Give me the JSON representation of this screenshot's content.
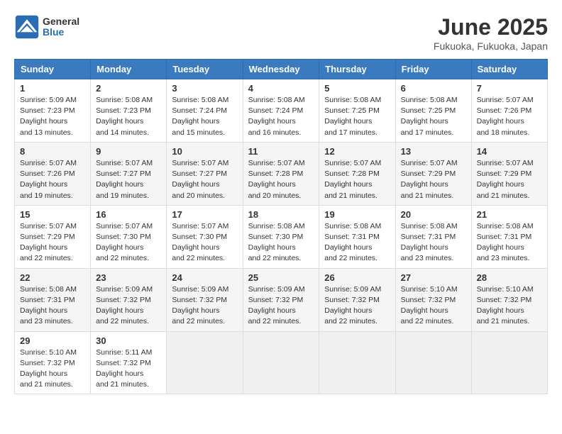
{
  "header": {
    "logo": {
      "general": "General",
      "blue": "Blue"
    },
    "title": "June 2025",
    "location": "Fukuoka, Fukuoka, Japan"
  },
  "calendar": {
    "days_of_week": [
      "Sunday",
      "Monday",
      "Tuesday",
      "Wednesday",
      "Thursday",
      "Friday",
      "Saturday"
    ],
    "weeks": [
      [
        {
          "day": 1,
          "sunrise": "5:09 AM",
          "sunset": "7:23 PM",
          "daylight": "14 hours and 13 minutes."
        },
        {
          "day": 2,
          "sunrise": "5:08 AM",
          "sunset": "7:23 PM",
          "daylight": "14 hours and 14 minutes."
        },
        {
          "day": 3,
          "sunrise": "5:08 AM",
          "sunset": "7:24 PM",
          "daylight": "14 hours and 15 minutes."
        },
        {
          "day": 4,
          "sunrise": "5:08 AM",
          "sunset": "7:24 PM",
          "daylight": "14 hours and 16 minutes."
        },
        {
          "day": 5,
          "sunrise": "5:08 AM",
          "sunset": "7:25 PM",
          "daylight": "14 hours and 17 minutes."
        },
        {
          "day": 6,
          "sunrise": "5:08 AM",
          "sunset": "7:25 PM",
          "daylight": "14 hours and 17 minutes."
        },
        {
          "day": 7,
          "sunrise": "5:07 AM",
          "sunset": "7:26 PM",
          "daylight": "14 hours and 18 minutes."
        }
      ],
      [
        {
          "day": 8,
          "sunrise": "5:07 AM",
          "sunset": "7:26 PM",
          "daylight": "14 hours and 19 minutes."
        },
        {
          "day": 9,
          "sunrise": "5:07 AM",
          "sunset": "7:27 PM",
          "daylight": "14 hours and 19 minutes."
        },
        {
          "day": 10,
          "sunrise": "5:07 AM",
          "sunset": "7:27 PM",
          "daylight": "14 hours and 20 minutes."
        },
        {
          "day": 11,
          "sunrise": "5:07 AM",
          "sunset": "7:28 PM",
          "daylight": "14 hours and 20 minutes."
        },
        {
          "day": 12,
          "sunrise": "5:07 AM",
          "sunset": "7:28 PM",
          "daylight": "14 hours and 21 minutes."
        },
        {
          "day": 13,
          "sunrise": "5:07 AM",
          "sunset": "7:29 PM",
          "daylight": "14 hours and 21 minutes."
        },
        {
          "day": 14,
          "sunrise": "5:07 AM",
          "sunset": "7:29 PM",
          "daylight": "14 hours and 21 minutes."
        }
      ],
      [
        {
          "day": 15,
          "sunrise": "5:07 AM",
          "sunset": "7:29 PM",
          "daylight": "14 hours and 22 minutes."
        },
        {
          "day": 16,
          "sunrise": "5:07 AM",
          "sunset": "7:30 PM",
          "daylight": "14 hours and 22 minutes."
        },
        {
          "day": 17,
          "sunrise": "5:07 AM",
          "sunset": "7:30 PM",
          "daylight": "14 hours and 22 minutes."
        },
        {
          "day": 18,
          "sunrise": "5:08 AM",
          "sunset": "7:30 PM",
          "daylight": "14 hours and 22 minutes."
        },
        {
          "day": 19,
          "sunrise": "5:08 AM",
          "sunset": "7:31 PM",
          "daylight": "14 hours and 22 minutes."
        },
        {
          "day": 20,
          "sunrise": "5:08 AM",
          "sunset": "7:31 PM",
          "daylight": "14 hours and 23 minutes."
        },
        {
          "day": 21,
          "sunrise": "5:08 AM",
          "sunset": "7:31 PM",
          "daylight": "14 hours and 23 minutes."
        }
      ],
      [
        {
          "day": 22,
          "sunrise": "5:08 AM",
          "sunset": "7:31 PM",
          "daylight": "14 hours and 23 minutes."
        },
        {
          "day": 23,
          "sunrise": "5:09 AM",
          "sunset": "7:32 PM",
          "daylight": "14 hours and 22 minutes."
        },
        {
          "day": 24,
          "sunrise": "5:09 AM",
          "sunset": "7:32 PM",
          "daylight": "14 hours and 22 minutes."
        },
        {
          "day": 25,
          "sunrise": "5:09 AM",
          "sunset": "7:32 PM",
          "daylight": "14 hours and 22 minutes."
        },
        {
          "day": 26,
          "sunrise": "5:09 AM",
          "sunset": "7:32 PM",
          "daylight": "14 hours and 22 minutes."
        },
        {
          "day": 27,
          "sunrise": "5:10 AM",
          "sunset": "7:32 PM",
          "daylight": "14 hours and 22 minutes."
        },
        {
          "day": 28,
          "sunrise": "5:10 AM",
          "sunset": "7:32 PM",
          "daylight": "14 hours and 21 minutes."
        }
      ],
      [
        {
          "day": 29,
          "sunrise": "5:10 AM",
          "sunset": "7:32 PM",
          "daylight": "14 hours and 21 minutes."
        },
        {
          "day": 30,
          "sunrise": "5:11 AM",
          "sunset": "7:32 PM",
          "daylight": "14 hours and 21 minutes."
        },
        null,
        null,
        null,
        null,
        null
      ]
    ]
  }
}
